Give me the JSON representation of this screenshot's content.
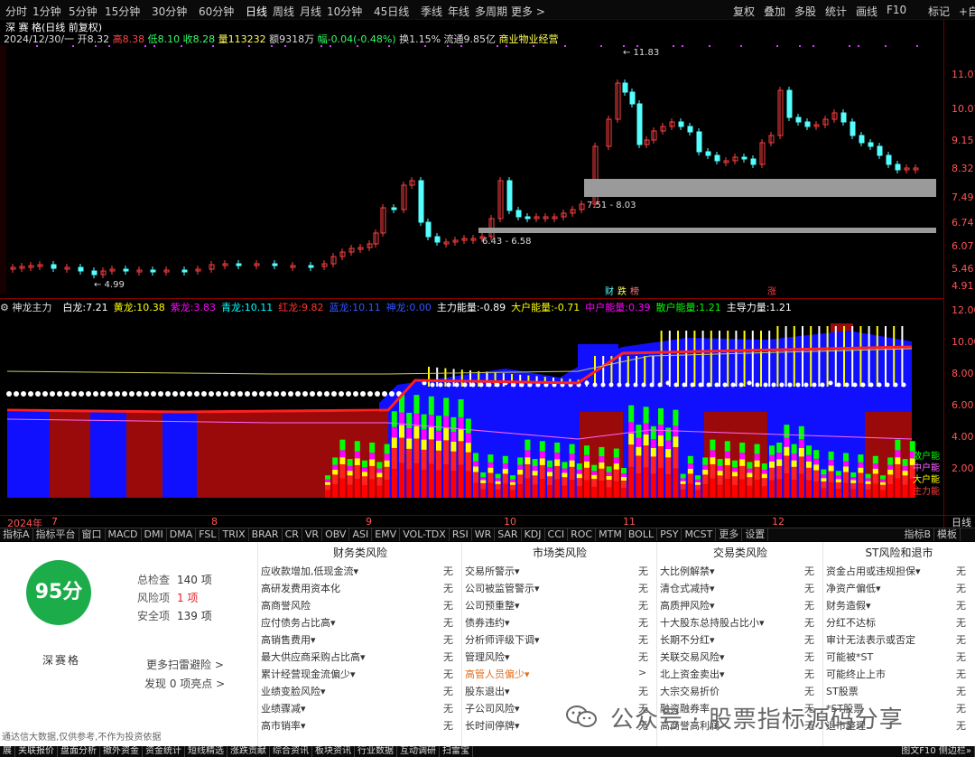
{
  "periods": [
    "分时",
    "1分钟",
    "5分钟",
    "15分钟",
    "30分钟",
    "60分钟",
    "日线",
    "周线",
    "月线",
    "10分钟",
    "45日线",
    "季线",
    "年线",
    "多周期",
    "更多 >"
  ],
  "right_buttons": [
    "复权",
    "叠加",
    "多股",
    "统计",
    "画线",
    "F10",
    "标记",
    "+自选"
  ],
  "stock": {
    "name": "深 赛 格(日线 前复权)",
    "date": "2024/12/30/一",
    "open_lbl": "开",
    "open": "8.32",
    "high_lbl": "高",
    "high": "8.38",
    "low_lbl": "低",
    "low": "8.10",
    "close_lbl": "收",
    "close": "8.28",
    "vol_lbl": "量",
    "vol": "113232",
    "amt_lbl": "额",
    "amt": "9318万",
    "chg_lbl": "幅",
    "chg": "-0.04(-0.48%)",
    "turn": "换1.15%",
    "float": "流通9.85亿",
    "sector": "商业物业经营"
  },
  "price_axis": [
    "11.07",
    "10.07",
    "9.15",
    "8.32",
    "7.49",
    "6.74",
    "6.07",
    "5.46",
    "4.91"
  ],
  "ind_axis": [
    "12.00",
    "10.00",
    "8.00",
    "6.00",
    "4.00",
    "2.00"
  ],
  "price_annotations": {
    "high": "11.83",
    "low": "4.99",
    "zone1": "7.51 - 8.03",
    "zone2": "6.43 - 6.58",
    "caiyin": [
      "财",
      "跌",
      "榜"
    ],
    "zhang": "涨"
  },
  "indicator": {
    "name": "神龙主力",
    "items": [
      [
        "白龙:",
        "7.21",
        "#ffffff"
      ],
      [
        "黄龙:",
        "10.38",
        "#ffff00"
      ],
      [
        "紫龙:",
        "3.83",
        "#ff00ff"
      ],
      [
        "青龙:",
        "10.11",
        "#00ffff"
      ],
      [
        "红龙:",
        "9.82",
        "#ff3333"
      ],
      [
        "蓝龙:",
        "10.11",
        "#3355ff"
      ],
      [
        "神龙:",
        "0.00",
        "#3355ff"
      ],
      [
        "主力能量:",
        "-0.89",
        "#ffffff"
      ],
      [
        "大户能量:",
        "-0.71",
        "#ffff00"
      ],
      [
        "中户能量:",
        "0.39",
        "#ff00ff"
      ],
      [
        "散户能量:",
        "1.21",
        "#00ff00"
      ],
      [
        "主导力量:",
        "1.21",
        "#ffffff"
      ]
    ],
    "legend": [
      "散户能",
      "中户能",
      "大户能",
      "主力能"
    ]
  },
  "dates": [
    "2024年",
    "7",
    "8",
    "9",
    "10",
    "11",
    "12"
  ],
  "period_label": "日线",
  "tabs": [
    "指标A",
    "指标平台",
    "窗口",
    "MACD",
    "DMI",
    "DMA",
    "FSL",
    "TRIX",
    "BRAR",
    "CR",
    "VR",
    "OBV",
    "ASI",
    "EMV",
    "VOL-TDX",
    "RSI",
    "WR",
    "SAR",
    "KDJ",
    "CCI",
    "ROC",
    "MTM",
    "BOLL",
    "PSY",
    "MCST",
    "更多",
    "设置"
  ],
  "tabs_right": [
    "指标B",
    "模板"
  ],
  "panel": {
    "score": "95分",
    "name": "深赛格",
    "stats": [
      [
        "总检查",
        "140 项",
        "#333"
      ],
      [
        "风险项",
        "1 项",
        "#e02020"
      ],
      [
        "安全项",
        "139 项",
        "#333"
      ]
    ],
    "more": "更多扫雷避险 >",
    "found": "发现 0 项亮点 >",
    "columns": [
      {
        "title": "财务类风险",
        "items": [
          [
            "应收款增加,低现金流▾",
            "无"
          ],
          [
            "高研发费用资本化",
            "无"
          ],
          [
            "高商誉风险",
            "无"
          ],
          [
            "应付债务占比高▾",
            "无"
          ],
          [
            "高销售费用▾",
            "无"
          ],
          [
            "最大供应商采购占比高▾",
            "无"
          ],
          [
            "累计经营现金流偏少▾",
            "无"
          ],
          [
            "业绩变脸风险▾",
            "无"
          ],
          [
            "业绩骤减▾",
            "无"
          ],
          [
            "高市销率▾",
            "无"
          ]
        ]
      },
      {
        "title": "市场类风险",
        "items": [
          [
            "交易所警示▾",
            "无"
          ],
          [
            "公司被监管警示▾",
            "无"
          ],
          [
            "公司预重整▾",
            "无"
          ],
          [
            "债券违约▾",
            "无"
          ],
          [
            "分析师评级下调▾",
            "无"
          ],
          [
            "管理风险▾",
            "无"
          ],
          [
            "高管人员偏少▾",
            ">"
          ],
          [
            "股东退出▾",
            "无"
          ],
          [
            "子公司风险▾",
            "无"
          ],
          [
            "长时间停牌▾",
            "无"
          ]
        ]
      },
      {
        "title": "交易类风险",
        "items": [
          [
            "大比例解禁▾",
            "无"
          ],
          [
            "清仓式减持▾",
            "无"
          ],
          [
            "高质押风险▾",
            "无"
          ],
          [
            "十大股东总持股占比小▾",
            "无"
          ],
          [
            "长期不分红▾",
            "无"
          ],
          [
            "关联交易风险▾",
            "无"
          ],
          [
            "北上资金卖出▾",
            "无"
          ],
          [
            "大宗交易折价",
            "无"
          ],
          [
            "融资融券率",
            "无"
          ],
          [
            "高商誉高利润",
            "无"
          ]
        ]
      },
      {
        "title": "ST风险和退市",
        "items": [
          [
            "资金占用或违规担保▾",
            "无"
          ],
          [
            "净资产偏低▾",
            "无"
          ],
          [
            "财务造假▾",
            "无"
          ],
          [
            "分红不达标",
            "无"
          ],
          [
            "审计无法表示或否定",
            "无"
          ],
          [
            "可能被*ST",
            "无"
          ],
          [
            "可能终止上市",
            "无"
          ],
          [
            "ST股票",
            "无"
          ],
          [
            "*ST股票",
            "无"
          ],
          [
            "退市整理",
            "无"
          ]
        ]
      }
    ]
  },
  "bottom_tabs": [
    "展",
    "关联报价",
    "盘面分析",
    "撤外资金",
    "资金统计",
    "短线精选",
    "涨跌贡献",
    "综合资讯",
    "板块资讯",
    "行业数据",
    "互动调研",
    "扫雷宝"
  ],
  "bottom_right": "图文F10 侧边栏»",
  "disclaimer": "通达信大数据,仅供参考,不作为投资依据",
  "watermark": "公众号 · 股票指标源码分享",
  "colors": {
    "up": "#ff3b3b",
    "down": "#54ffff",
    "axis": "#ff5555",
    "panel_green": "#1cad4a"
  }
}
